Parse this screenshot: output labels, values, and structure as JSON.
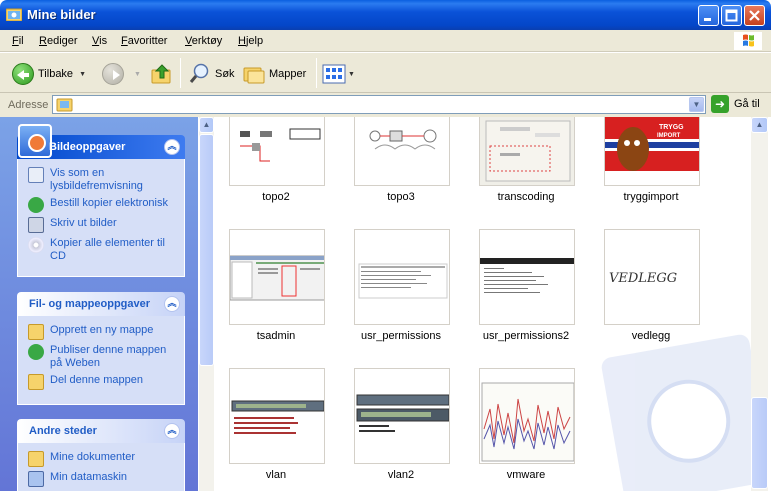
{
  "window": {
    "title": "Mine bilder"
  },
  "menu": [
    "Fil",
    "Rediger",
    "Vis",
    "Favoritter",
    "Verktøy",
    "Hjelp"
  ],
  "toolbar": {
    "back": "Tilbake",
    "search": "Søk",
    "folders": "Mapper"
  },
  "address": {
    "label": "Adresse",
    "value": "",
    "go": "Gå til"
  },
  "panes": {
    "picture_tasks": {
      "title": "Bildeoppgaver",
      "items": [
        "Vis som en lysbildefremvisning",
        "Bestill kopier elektronisk",
        "Skriv ut bilder",
        "Kopier alle elementer til CD"
      ]
    },
    "file_tasks": {
      "title": "Fil- og mappeoppgaver",
      "items": [
        "Opprett en ny mappe",
        "Publiser denne mappen på Weben",
        "Del denne mappen"
      ]
    },
    "other_places": {
      "title": "Andre steder",
      "items": [
        "Mine dokumenter",
        "Min datamaskin"
      ]
    }
  },
  "files": [
    {
      "name": "topo2"
    },
    {
      "name": "topo3"
    },
    {
      "name": "transcoding"
    },
    {
      "name": "tryggimport"
    },
    {
      "name": "tsadmin"
    },
    {
      "name": "usr_permissions"
    },
    {
      "name": "usr_permissions2"
    },
    {
      "name": "vedlegg"
    },
    {
      "name": "vlan"
    },
    {
      "name": "vlan2"
    },
    {
      "name": "vmware"
    }
  ],
  "thumb_text": {
    "trygg": "TRYGG",
    "import": "IMPORT",
    "vedlegg_sig": "VEDLEGG"
  },
  "colors": {
    "title_bar": "#0a52d8",
    "task_pane_bg": "#6375d6",
    "link": "#215dc6"
  }
}
